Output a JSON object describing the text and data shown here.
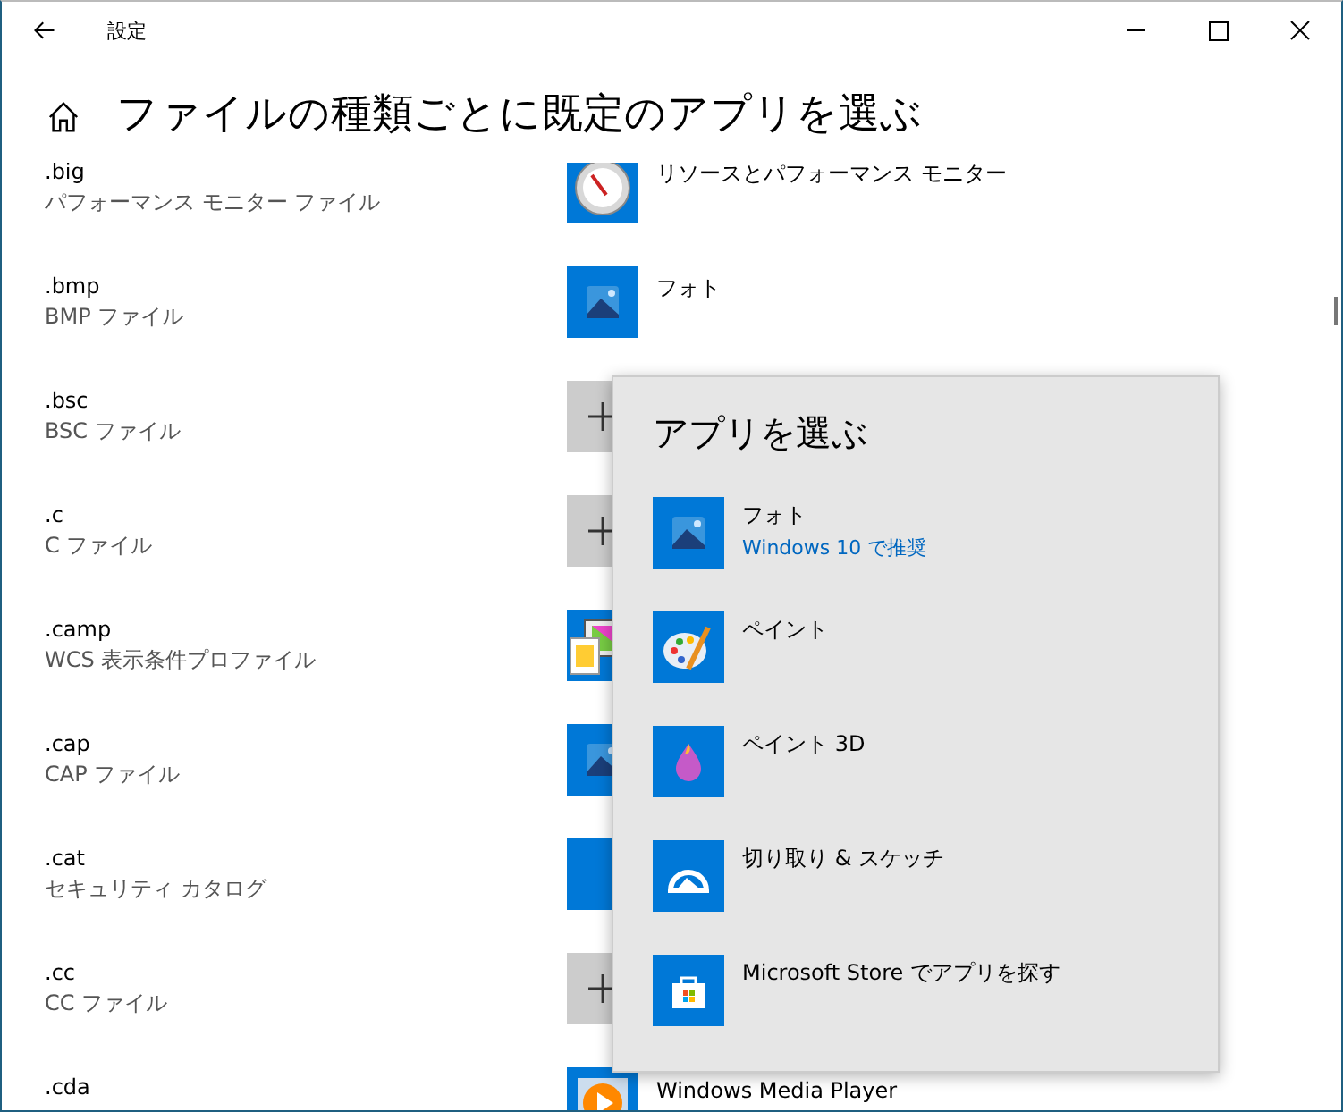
{
  "window": {
    "title": "設定"
  },
  "page_title": "ファイルの種類ごとに既定のアプリを選ぶ",
  "file_types": [
    {
      "extension": ".big",
      "description": "パフォーマンス モニター ファイル",
      "kind": "gauge",
      "app": "リソースとパフォーマンス モニター"
    },
    {
      "extension": ".bmp",
      "description": "BMP ファイル",
      "kind": "photo",
      "app": "フォト"
    },
    {
      "extension": ".bsc",
      "description": "BSC ファイル",
      "kind": "plus"
    },
    {
      "extension": ".c",
      "description": "C ファイル",
      "kind": "plus"
    },
    {
      "extension": ".camp",
      "description": "WCS 表示条件プロファイル",
      "kind": "monitor"
    },
    {
      "extension": ".cap",
      "description": "CAP ファイル",
      "kind": "photo"
    },
    {
      "extension": ".cat",
      "description": "セキュリティ カタログ",
      "kind": "blank"
    },
    {
      "extension": ".cc",
      "description": "CC ファイル",
      "kind": "plus"
    },
    {
      "extension": ".cda",
      "kind": "media",
      "app": "Windows Media Player"
    }
  ],
  "app_picker": {
    "title": "アプリを選ぶ",
    "apps": [
      {
        "name": "フォト",
        "note": "Windows 10 で推奨",
        "kind": "photo"
      },
      {
        "name": "ペイント",
        "kind": "palette"
      },
      {
        "name": "ペイント 3D",
        "kind": "drop"
      },
      {
        "name": "切り取り & スケッチ",
        "kind": "snip"
      },
      {
        "name": "Microsoft Store でアプリを探す",
        "kind": "store"
      }
    ]
  }
}
